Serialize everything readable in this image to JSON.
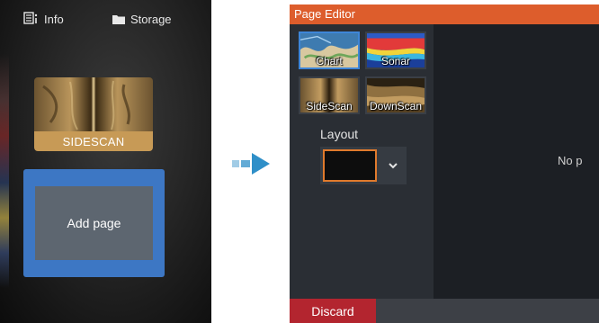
{
  "left_panel": {
    "top_bar": {
      "info_label": "Info",
      "info_icon": "info-pages-icon",
      "storage_label": "Storage",
      "storage_icon": "folder-icon"
    },
    "page_tile": {
      "label": "SIDESCAN"
    },
    "add_page": {
      "label": "Add page"
    }
  },
  "transition_arrow": "arrow-right-icon",
  "editor": {
    "title": "Page Editor",
    "apps": [
      {
        "label": "Chart",
        "selected": true
      },
      {
        "label": "Sonar",
        "selected": false
      },
      {
        "label": "SideScan",
        "selected": false
      },
      {
        "label": "DownScan",
        "selected": false
      }
    ],
    "layout": {
      "label": "Layout",
      "dropdown_icon": "chevron-down-icon"
    },
    "canvas": {
      "message": "No p"
    },
    "footer": {
      "discard_label": "Discard"
    }
  },
  "colors": {
    "title_bar": "#dd5d2c",
    "add_page_frame": "#3d77c4",
    "discard": "#b3252f",
    "sidescan_caption": "#c79a56",
    "arrow": "#2f8fc8",
    "layout_highlight": "#e07a2c"
  }
}
